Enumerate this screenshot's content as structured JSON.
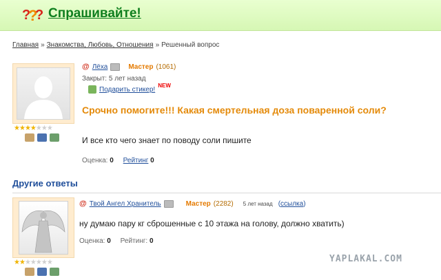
{
  "header": {
    "logo_icon": "question-marks-icon",
    "title": "Спрашивайте!"
  },
  "breadcrumb": {
    "items": [
      "Главная",
      "Знакомства, Любовь, Отношения",
      "Решенный вопрос"
    ],
    "separator": "»"
  },
  "question": {
    "author": "Лёха",
    "rank": "Мастер",
    "points": "(1061)",
    "closed": "Закрыт: 5 лет назад",
    "gift_label": "Подарить стикер!",
    "new_badge": "NEW",
    "title": "Срочно помогите!!! Какая смертельная доза поваренной соли?",
    "body": "И все кто чего знает по поводу соли пишите",
    "score_label": "Оценка:",
    "score_value": "0",
    "rating_label": "Рейтинг",
    "rating_value": "0",
    "stars_filled": 4,
    "stars_total": 7
  },
  "other_answers": {
    "heading": "Другие ответы"
  },
  "answer": {
    "author": "Твой Ангел Хранитель",
    "rank": "Мастер",
    "points": "(2282)",
    "date": "5 лет назад",
    "link_open": "(",
    "link_label": "ссылка",
    "link_close": ")",
    "body": "ну думаю пару кг сброшенные с 10 этажа на голову, должно хватить)",
    "score_label": "Оценка:",
    "score_value": "0",
    "rating_label": "Рейтинг:",
    "rating_value": "0",
    "stars_filled": 2,
    "stars_total": 7
  },
  "watermark": "YAPLAKAL.COM",
  "colors": {
    "brand_green": "#0f7f1f",
    "header_bg": "#d6f7b4",
    "question_orange": "#e48a0a",
    "rank_orange": "#e47a00",
    "link_blue": "#1f4e9a"
  }
}
